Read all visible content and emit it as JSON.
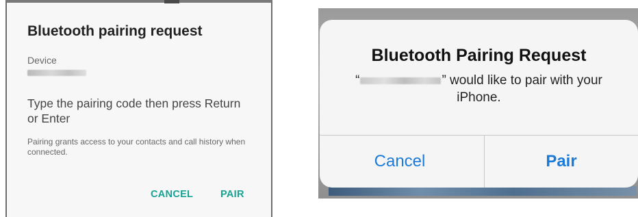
{
  "android_dialog": {
    "title": "Bluetooth pairing request",
    "device_label": "Device",
    "instruction": "Type the pairing code then press Return or Enter",
    "note": "Pairing grants access to your contacts and call history when connected.",
    "cancel_label": "CANCEL",
    "pair_label": "PAIR",
    "accent_color": "#16a391"
  },
  "ios_alert": {
    "title": "Bluetooth Pairing Request",
    "message_prefix": "“",
    "message_suffix": "” would like to pair with your iPhone.",
    "cancel_label": "Cancel",
    "pair_label": "Pair",
    "accent_color": "#1b7bd8"
  }
}
